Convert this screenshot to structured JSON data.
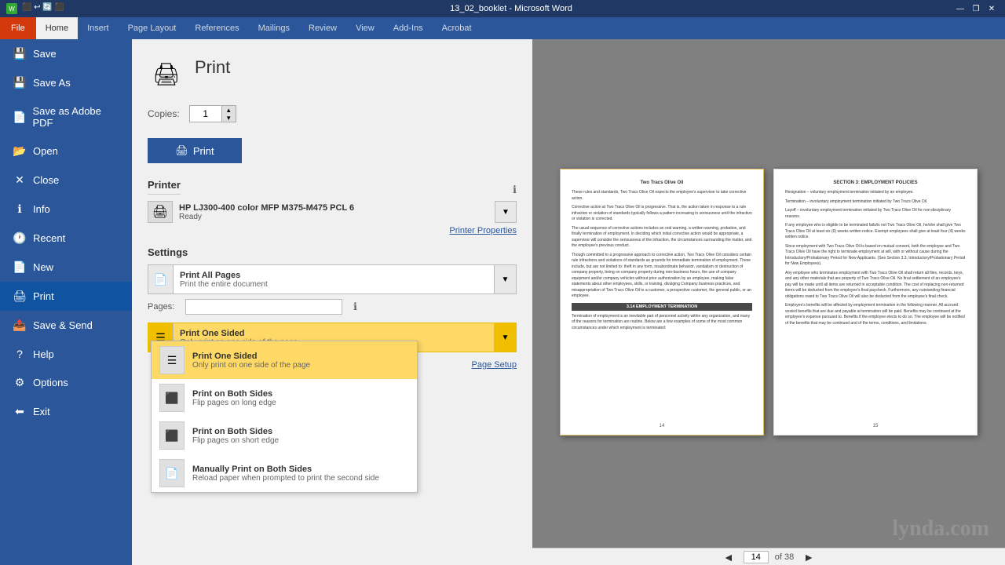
{
  "titleBar": {
    "title": "13_02_booklet - Microsoft Word",
    "minimize": "—",
    "restore": "❐",
    "close": "✕"
  },
  "ribbonTabs": [
    {
      "label": "File",
      "key": "file"
    },
    {
      "label": "Home",
      "key": "home"
    },
    {
      "label": "Insert",
      "key": "insert"
    },
    {
      "label": "Page Layout",
      "key": "page-layout"
    },
    {
      "label": "References",
      "key": "references"
    },
    {
      "label": "Mailings",
      "key": "mailings"
    },
    {
      "label": "Review",
      "key": "review"
    },
    {
      "label": "View",
      "key": "view"
    },
    {
      "label": "Add-Ins",
      "key": "add-ins"
    },
    {
      "label": "Acrobat",
      "key": "acrobat"
    }
  ],
  "sidebar": {
    "items": [
      {
        "label": "Save",
        "icon": "💾",
        "key": "save"
      },
      {
        "label": "Save As",
        "icon": "💾",
        "key": "save-as"
      },
      {
        "label": "Save as Adobe PDF",
        "icon": "📄",
        "key": "save-pdf"
      },
      {
        "label": "Open",
        "icon": "📂",
        "key": "open"
      },
      {
        "label": "Close",
        "icon": "✕",
        "key": "close"
      },
      {
        "label": "Info",
        "icon": "ℹ",
        "key": "info"
      },
      {
        "label": "Recent",
        "icon": "🕐",
        "key": "recent"
      },
      {
        "label": "New",
        "icon": "📄",
        "key": "new"
      },
      {
        "label": "Print",
        "icon": "🖨",
        "key": "print"
      },
      {
        "label": "Save & Send",
        "icon": "📤",
        "key": "save-send"
      },
      {
        "label": "Help",
        "icon": "?",
        "key": "help"
      },
      {
        "label": "Options",
        "icon": "⚙",
        "key": "options"
      },
      {
        "label": "Exit",
        "icon": "⬅",
        "key": "exit"
      }
    ]
  },
  "print": {
    "title": "Print",
    "copies_label": "Copies:",
    "copies_value": "1",
    "print_button": "Print",
    "printer_section": "Printer",
    "printer_name": "HP LJ300-400 color MFP M375-M475 PCL 6",
    "printer_status": "Ready",
    "printer_properties": "Printer Properties",
    "settings_label": "Settings",
    "print_all_pages": "Print All Pages",
    "print_all_pages_sub": "Print the entire document",
    "pages_label": "Pages:",
    "pages_value": "",
    "selected_print_mode": "Print One Sided",
    "selected_print_mode_sub": "Only print on one side of the page",
    "page_setup": "Page Setup"
  },
  "dropdown": {
    "options": [
      {
        "key": "one-sided",
        "main": "Print One Sided",
        "sub": "Only print on one side of the page",
        "selected": true
      },
      {
        "key": "both-sides-long",
        "main": "Print on Both Sides",
        "sub": "Flip pages on long edge",
        "selected": false
      },
      {
        "key": "both-sides-short",
        "main": "Print on Both Sides",
        "sub": "Flip pages on short edge",
        "selected": false
      },
      {
        "key": "manually-both",
        "main": "Manually Print on Both Sides",
        "sub": "Reload paper when prompted to print the second side",
        "selected": false
      }
    ]
  },
  "navigation": {
    "prev": "◄",
    "next": "►",
    "current_page": "14",
    "total": "of 38"
  },
  "preview": {
    "left_page_number": "14",
    "right_page_number": "15",
    "left_title": "Two Tracs Olive Oil",
    "right_title": "SECTION 3: EMPLOYMENT POLICIES",
    "section_header": "3.14 EMPLOYMENT TERMINATION"
  },
  "watermark": {
    "text": "lynda.com"
  }
}
